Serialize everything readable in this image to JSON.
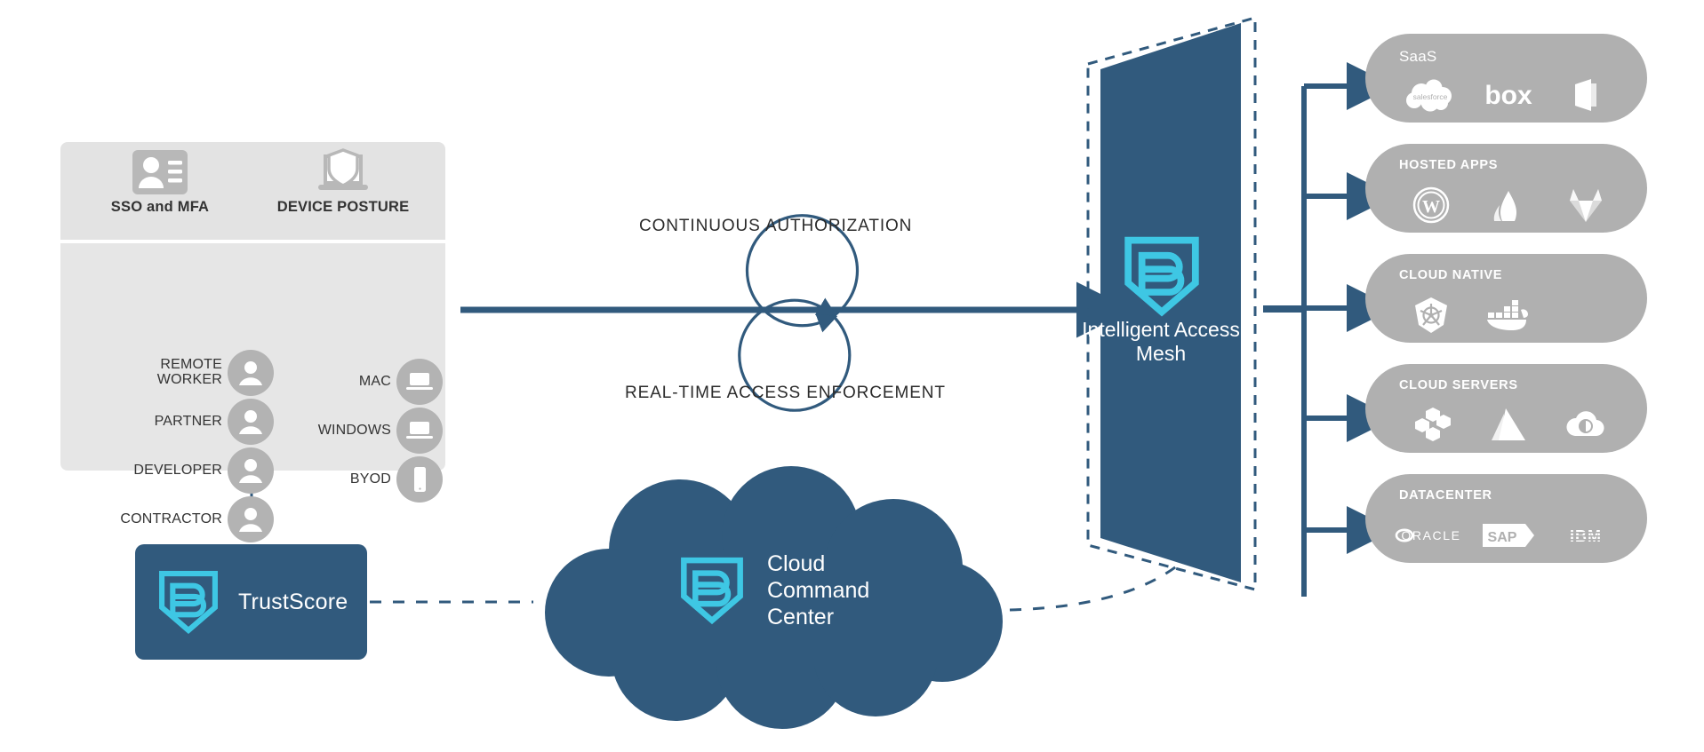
{
  "theme": {
    "brand_dark_blue": "#315a7d",
    "brand_cyan": "#3ec7e4",
    "panel_gray": "#e6e6e6",
    "card_gray": "#b0b0b0",
    "arrow_blue": "#315a7d",
    "text_dark": "#2b2b2b"
  },
  "identity_panel": {
    "columns": [
      {
        "icon": "id-badge-icon",
        "label": "SSO and MFA"
      },
      {
        "icon": "laptop-shield-icon",
        "label": "DEVICE POSTURE"
      }
    ],
    "users": [
      {
        "label": "REMOTE\nWORKER",
        "icon": "person-icon"
      },
      {
        "label": "PARTNER",
        "icon": "person-icon"
      },
      {
        "label": "DEVELOPER",
        "icon": "person-icon"
      },
      {
        "label": "CONTRACTOR",
        "icon": "person-icon"
      }
    ],
    "devices": [
      {
        "label": "MAC",
        "icon": "laptop-icon"
      },
      {
        "label": "WINDOWS",
        "icon": "laptop-icon"
      },
      {
        "label": "BYOD",
        "icon": "mobile-phone-icon"
      }
    ]
  },
  "flow": {
    "top_label": "CONTINUOUS AUTHORIZATION",
    "bottom_label": "REAL-TIME ACCESS ENFORCEMENT"
  },
  "mesh": {
    "logo": "banyan-shield-b-icon",
    "title": "Intelligent\nAccess\nMesh"
  },
  "trustscore": {
    "logo": "banyan-shield-b-icon",
    "label": "TrustScore"
  },
  "cloud": {
    "logo": "banyan-shield-b-icon",
    "label": "Cloud\nCommand\nCenter"
  },
  "service_cards": [
    {
      "title": "SaaS",
      "title_style": "mixed",
      "logos": [
        {
          "name": "salesforce-logo",
          "text": "salesforce"
        },
        {
          "name": "box-logo",
          "text": "box"
        },
        {
          "name": "office365-logo",
          "text": ""
        }
      ]
    },
    {
      "title": "HOSTED APPS",
      "title_style": "upper",
      "logos": [
        {
          "name": "wordpress-logo",
          "text": ""
        },
        {
          "name": "atlassian-logo",
          "text": ""
        },
        {
          "name": "gitlab-logo",
          "text": ""
        }
      ]
    },
    {
      "title": "CLOUD NATIVE",
      "title_style": "upper",
      "logos": [
        {
          "name": "kubernetes-logo",
          "text": ""
        },
        {
          "name": "docker-logo",
          "text": ""
        }
      ]
    },
    {
      "title": "CLOUD SERVERS",
      "title_style": "upper",
      "logos": [
        {
          "name": "aws-ec2-logo",
          "text": ""
        },
        {
          "name": "microsoft-azure-logo",
          "text": ""
        },
        {
          "name": "google-cloud-logo",
          "text": ""
        }
      ]
    },
    {
      "title": "DATACENTER",
      "title_style": "upper",
      "logos": [
        {
          "name": "oracle-logo",
          "text": "ORACLE"
        },
        {
          "name": "sap-logo",
          "text": "SAP"
        },
        {
          "name": "ibm-logo",
          "text": "IBM"
        }
      ]
    }
  ]
}
